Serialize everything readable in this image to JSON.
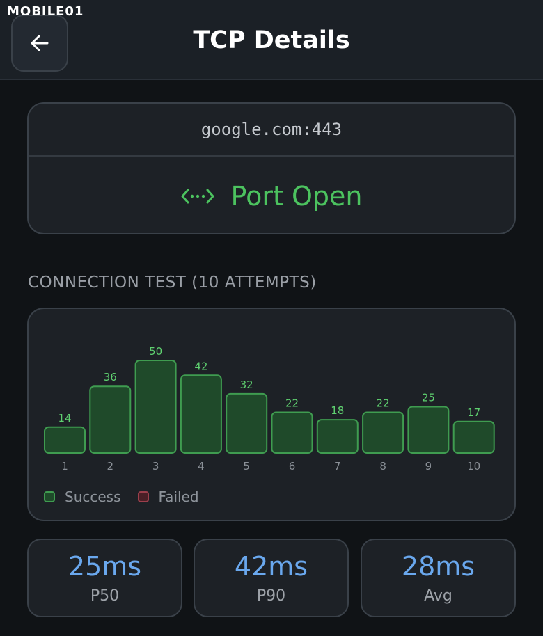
{
  "watermark": "MOBILE01",
  "header": {
    "title": "TCP Details",
    "back_icon": "arrow-left-icon"
  },
  "target": {
    "host": "google.com:443",
    "status": "Port Open",
    "status_icon": "code-brackets-icon",
    "status_color": "#4cc35f"
  },
  "section": {
    "label": "CONNECTION TEST (10 ATTEMPTS)"
  },
  "chart_data": {
    "type": "bar",
    "categories": [
      "1",
      "2",
      "3",
      "4",
      "5",
      "6",
      "7",
      "8",
      "9",
      "10"
    ],
    "values": [
      14,
      36,
      50,
      42,
      32,
      22,
      18,
      22,
      25,
      17
    ],
    "series": [
      {
        "name": "Success",
        "values": [
          14,
          36,
          50,
          42,
          32,
          22,
          18,
          22,
          25,
          17
        ]
      }
    ],
    "ylim": [
      0,
      50
    ],
    "legend": [
      "Success",
      "Failed"
    ],
    "legend_placement": "bottom-left",
    "colors": {
      "success_fill": "#1f4a2a",
      "success_stroke": "#3f9c50",
      "failed_fill": "#4a1f26",
      "failed_stroke": "#9c3f4c",
      "label": "#5fd170"
    }
  },
  "legend": {
    "success": "Success",
    "failed": "Failed"
  },
  "stats": [
    {
      "value": "25ms",
      "label": "P50"
    },
    {
      "value": "42ms",
      "label": "P90"
    },
    {
      "value": "28ms",
      "label": "Avg"
    }
  ],
  "colors": {
    "accent_blue": "#6aa8ee",
    "background": "#101316",
    "card": "#1d2126"
  }
}
